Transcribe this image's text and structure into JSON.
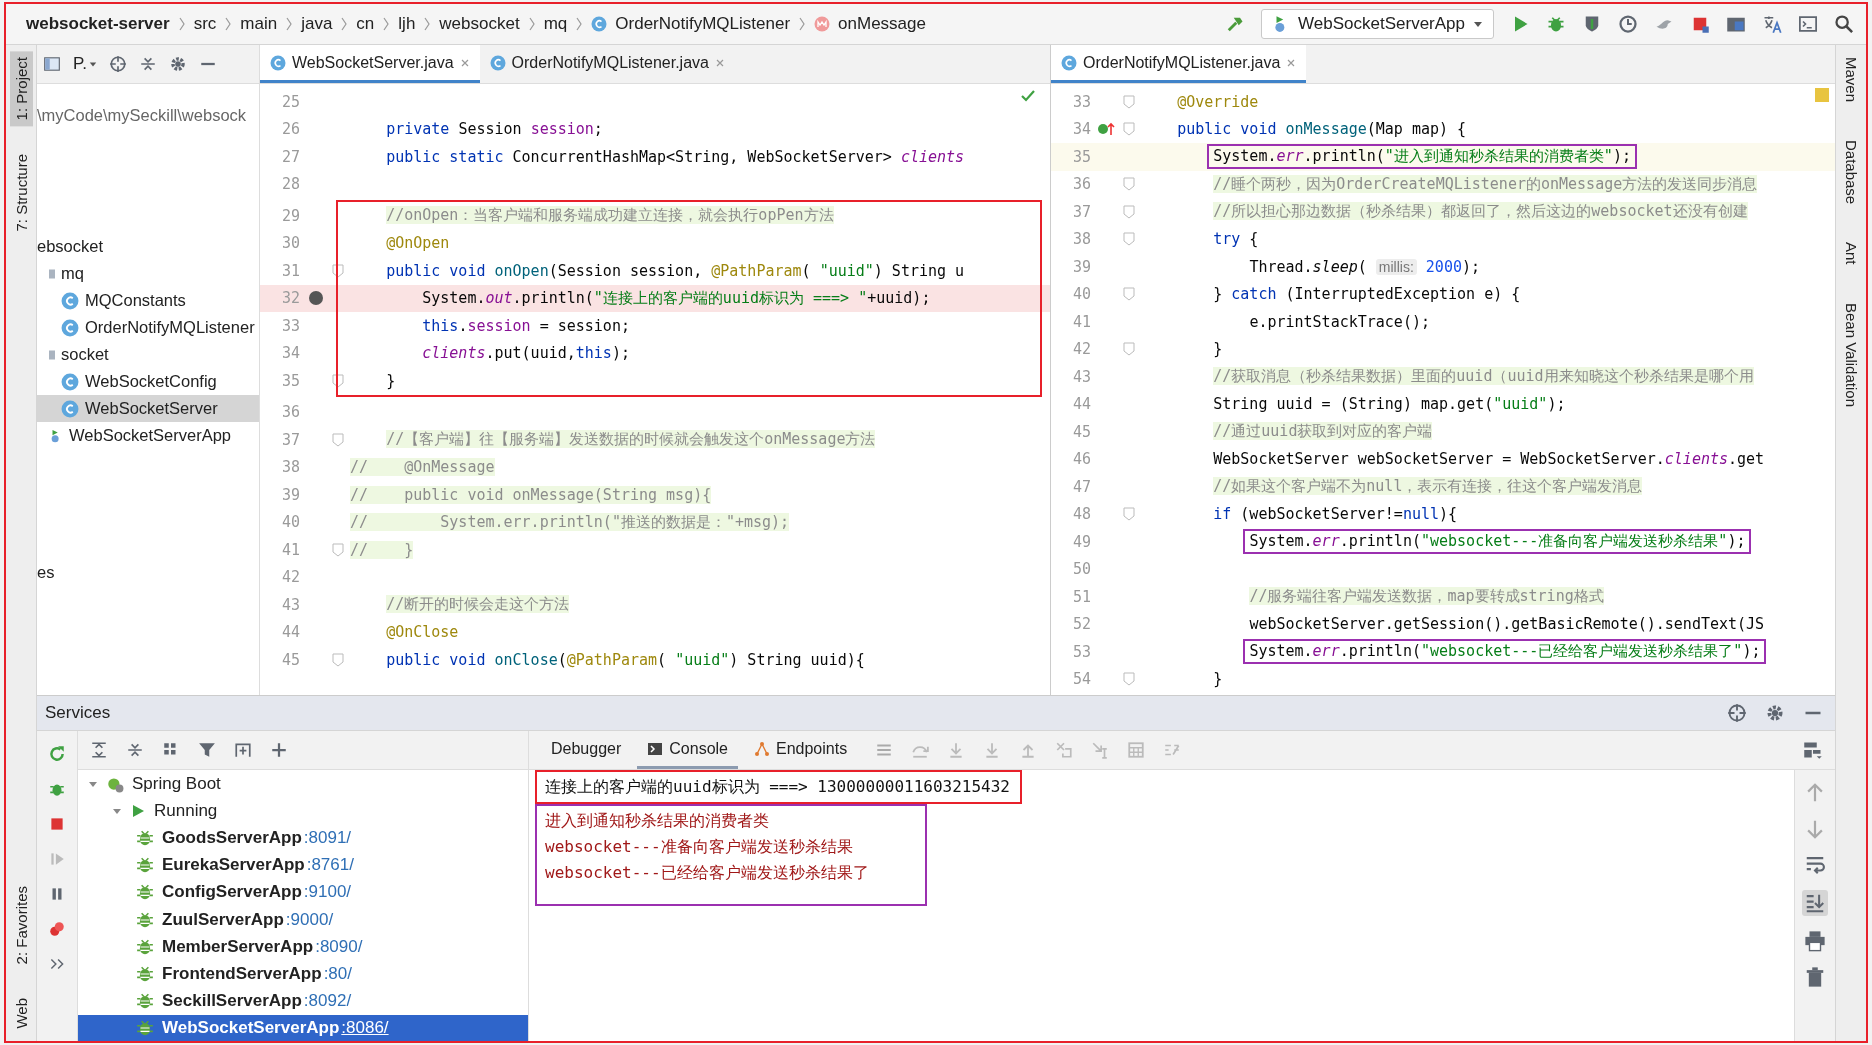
{
  "window": {
    "color": "#e8202a"
  },
  "breadcrumb": [
    {
      "label": "websocket-server",
      "kind": "project"
    },
    {
      "label": "src",
      "kind": "dir"
    },
    {
      "label": "main",
      "kind": "dir"
    },
    {
      "label": "java",
      "kind": "dir"
    },
    {
      "label": "cn",
      "kind": "dir"
    },
    {
      "label": "ljh",
      "kind": "dir"
    },
    {
      "label": "websocket",
      "kind": "dir"
    },
    {
      "label": "mq",
      "kind": "dir"
    },
    {
      "label": "OrderNotifyMQListener",
      "kind": "class"
    },
    {
      "label": "onMessage",
      "kind": "method"
    }
  ],
  "run_config": {
    "label": "WebSocketServerApp"
  },
  "tool_windows_left_top": [
    {
      "label": "1: Project",
      "selected": true
    },
    {
      "label": "7: Structure",
      "selected": false
    }
  ],
  "tool_windows_left_bottom": [
    {
      "label": "2: Favorites",
      "selected": false
    },
    {
      "label": "Web",
      "selected": false
    }
  ],
  "tool_windows_right": [
    {
      "label": "Maven",
      "selected": false
    },
    {
      "label": "Database",
      "selected": false
    },
    {
      "label": "Ant",
      "selected": false
    },
    {
      "label": "Bean Validation",
      "selected": false
    }
  ],
  "project_panel": {
    "title": "P.",
    "items": [
      {
        "label": "\\myCode\\mySeckill\\websock",
        "kind": "path",
        "selected": false
      },
      {
        "label": "ebsocket",
        "kind": "text",
        "selected": false,
        "children": [
          {
            "label": "mq",
            "kind": "folder",
            "selected": false,
            "children": [
              {
                "label": "MQConstants",
                "kind": "class",
                "selected": false
              },
              {
                "label": "OrderNotifyMQListener",
                "kind": "class",
                "selected": false
              }
            ]
          },
          {
            "label": "socket",
            "kind": "folder",
            "selected": false,
            "children": [
              {
                "label": "WebSocketConfig",
                "kind": "class",
                "selected": false
              },
              {
                "label": "WebSocketServer",
                "kind": "class",
                "selected": true
              }
            ]
          },
          {
            "label": "WebSocketServerApp",
            "kind": "app",
            "selected": false
          }
        ]
      },
      {
        "label": "es",
        "kind": "text",
        "selected": false
      }
    ]
  },
  "editors": [
    {
      "tabs": [
        {
          "label": "WebSocketServer.java",
          "selected": true
        },
        {
          "label": "OrderNotifyMQListener.java",
          "selected": false
        }
      ],
      "blocks": [
        {
          "lines": [
            {
              "n": "25",
              "kind": "plain",
              "fold": false
            },
            {
              "n": "26",
              "kind": "plain",
              "fold": false,
              "tokens": [
                {
                  "text": "    private ",
                  "kind": "keyword"
                },
                {
                  "text": "Session ",
                  "kind": "plain"
                },
                {
                  "text": "session",
                  "kind": "field"
                },
                {
                  "text": ";",
                  "kind": "plain"
                }
              ]
            },
            {
              "n": "27",
              "kind": "plain",
              "fold": false,
              "tokens": [
                {
                  "text": "    public static ",
                  "kind": "keyword"
                },
                {
                  "text": "ConcurrentHashMap<String, WebSocketServer> ",
                  "kind": "plain"
                },
                {
                  "text": "clients",
                  "kind": "static"
                }
              ]
            },
            {
              "n": "28",
              "kind": "plain",
              "fold": false
            }
          ]
        },
        {
          "color": "#e8202a",
          "lines": [
            {
              "n": "29",
              "kind": "plain",
              "fold": false,
              "tokens": [
                {
                  "text": "    //onOpen：当客户端和服务端成功建立连接，就会执行opPen方法",
                  "kind": "comment"
                }
              ]
            },
            {
              "n": "30",
              "kind": "plain",
              "fold": false,
              "tokens": [
                {
                  "text": "    @OnOpen",
                  "kind": "annotation"
                }
              ]
            },
            {
              "n": "31",
              "kind": "plain",
              "fold": true,
              "tokens": [
                {
                  "text": "    public void ",
                  "kind": "keyword"
                },
                {
                  "text": "onOpen",
                  "kind": "method"
                },
                {
                  "text": "(Session session, ",
                  "kind": "plain"
                },
                {
                  "text": "@PathParam",
                  "kind": "annotation"
                },
                {
                  "text": "( ",
                  "kind": "plain"
                },
                {
                  "text": "\"uuid\"",
                  "kind": "string"
                },
                {
                  "text": ") String u",
                  "kind": "plain"
                }
              ]
            },
            {
              "n": "32",
              "kind": "breakpoint",
              "fold": false,
              "tokens": [
                {
                  "text": "        System.",
                  "kind": "plain"
                },
                {
                  "text": "out",
                  "kind": "static"
                },
                {
                  "text": ".println(",
                  "kind": "plain"
                },
                {
                  "text": "\"连接上的客户端的uuid标识为 ===> \"",
                  "kind": "string"
                },
                {
                  "text": "+uuid);",
                  "kind": "plain"
                }
              ]
            },
            {
              "n": "33",
              "kind": "plain",
              "fold": false,
              "tokens": [
                {
                  "text": "        this",
                  "kind": "keyword"
                },
                {
                  "text": ".",
                  "kind": "plain"
                },
                {
                  "text": "session",
                  "kind": "field"
                },
                {
                  "text": " = session;",
                  "kind": "plain"
                }
              ]
            },
            {
              "n": "34",
              "kind": "plain",
              "fold": false,
              "tokens": [
                {
                  "text": "        clients",
                  "kind": "static"
                },
                {
                  "text": ".put(uuid,",
                  "kind": "plain"
                },
                {
                  "text": "this",
                  "kind": "keyword"
                },
                {
                  "text": ");",
                  "kind": "plain"
                }
              ]
            },
            {
              "n": "35",
              "kind": "plain",
              "fold": true,
              "tokens": [
                {
                  "text": "    }",
                  "kind": "plain"
                }
              ]
            }
          ]
        },
        {
          "lines": [
            {
              "n": "36",
              "kind": "plain",
              "fold": false
            },
            {
              "n": "37",
              "kind": "plain",
              "fold": true,
              "tokens": [
                {
                  "text": "    //【客户端】往【服务端】发送数据的时候就会触发这个onMessage方法",
                  "kind": "comment"
                }
              ]
            },
            {
              "n": "38",
              "kind": "plain",
              "fold": false,
              "tokens": [
                {
                  "text": "//    @OnMessage",
                  "kind": "comment"
                }
              ]
            },
            {
              "n": "39",
              "kind": "plain",
              "fold": false,
              "tokens": [
                {
                  "text": "//    public void onMessage(String msg){",
                  "kind": "comment"
                }
              ]
            },
            {
              "n": "40",
              "kind": "plain",
              "fold": false,
              "tokens": [
                {
                  "text": "//        System.err.println(\"推送的数据是：\"+msg);",
                  "kind": "comment"
                }
              ]
            },
            {
              "n": "41",
              "kind": "plain",
              "fold": true,
              "tokens": [
                {
                  "text": "//    }",
                  "kind": "comment"
                }
              ]
            },
            {
              "n": "42",
              "kind": "plain",
              "fold": false
            },
            {
              "n": "43",
              "kind": "plain",
              "fold": false,
              "tokens": [
                {
                  "text": "    //断开的时候会走这个方法",
                  "kind": "comment"
                }
              ]
            },
            {
              "n": "44",
              "kind": "plain",
              "fold": false,
              "tokens": [
                {
                  "text": "    @OnClose",
                  "kind": "annotation"
                }
              ]
            },
            {
              "n": "45",
              "kind": "plain",
              "fold": true,
              "tokens": [
                {
                  "text": "    public void ",
                  "kind": "keyword"
                },
                {
                  "text": "onClose",
                  "kind": "method"
                },
                {
                  "text": "(",
                  "kind": "plain"
                },
                {
                  "text": "@PathParam",
                  "kind": "annotation"
                },
                {
                  "text": "( ",
                  "kind": "plain"
                },
                {
                  "text": "\"uuid\"",
                  "kind": "string"
                },
                {
                  "text": ") String uuid){",
                  "kind": "plain"
                }
              ]
            }
          ]
        }
      ]
    },
    {
      "tabs": [
        {
          "label": "OrderNotifyMQListener.java",
          "selected": true
        }
      ],
      "blocks": [
        {
          "lines": [
            {
              "n": "33",
              "kind": "plain",
              "fold": true,
              "tokens": [
                {
                  "text": "    @Override",
                  "kind": "annotation"
                }
              ]
            },
            {
              "n": "34",
              "kind": "implements",
              "fold": true,
              "tokens": [
                {
                  "text": "    public void ",
                  "kind": "keyword"
                },
                {
                  "text": "onMessage",
                  "kind": "method"
                },
                {
                  "text": "(Map map) {",
                  "kind": "plain"
                }
              ]
            },
            {
              "n": "35",
              "kind": "current",
              "fold": false,
              "color": "#9b30b0",
              "tokens": [
                {
                  "text": "        System.",
                  "kind": "plain"
                },
                {
                  "text": "err",
                  "kind": "static"
                },
                {
                  "text": ".println(",
                  "kind": "plain"
                },
                {
                  "text": "\"进入到通知秒杀结果的消费者类\"",
                  "kind": "string"
                },
                {
                  "text": ");",
                  "kind": "plain"
                }
              ]
            },
            {
              "n": "36",
              "kind": "plain",
              "fold": true,
              "tokens": [
                {
                  "text": "        //睡个两秒，因为OrderCreateMQListener的onMessage方法的发送同步消息",
                  "kind": "comment"
                }
              ]
            },
            {
              "n": "37",
              "kind": "plain",
              "fold": true,
              "tokens": [
                {
                  "text": "        //所以担心那边数据（秒杀结果）都返回了，然后这边的websocket还没有创建",
                  "kind": "comment"
                }
              ]
            },
            {
              "n": "38",
              "kind": "plain",
              "fold": true,
              "tokens": [
                {
                  "text": "        try",
                  "kind": "keyword"
                },
                {
                  "text": " {",
                  "kind": "plain"
                }
              ]
            },
            {
              "n": "39",
              "kind": "plain",
              "fold": false,
              "tokens": [
                {
                  "text": "            Thread.",
                  "kind": "plain"
                },
                {
                  "text": "sleep",
                  "kind": "italic"
                },
                {
                  "text": "( ",
                  "kind": "plain"
                },
                {
                  "text": "millis:",
                  "kind": "hint"
                },
                {
                  "text": " 2000",
                  "kind": "number"
                },
                {
                  "text": ");",
                  "kind": "plain"
                }
              ]
            },
            {
              "n": "40",
              "kind": "plain",
              "fold": true,
              "tokens": [
                {
                  "text": "        } ",
                  "kind": "plain"
                },
                {
                  "text": "catch",
                  "kind": "keyword"
                },
                {
                  "text": " (InterruptedException e) {",
                  "kind": "plain"
                }
              ]
            },
            {
              "n": "41",
              "kind": "plain",
              "fold": false,
              "tokens": [
                {
                  "text": "            e.printStackTrace();",
                  "kind": "plain"
                }
              ]
            },
            {
              "n": "42",
              "kind": "plain",
              "fold": true,
              "tokens": [
                {
                  "text": "        }",
                  "kind": "plain"
                }
              ]
            },
            {
              "n": "43",
              "kind": "plain",
              "fold": false,
              "tokens": [
                {
                  "text": "        //获取消息（秒杀结果数据）里面的uuid（uuid用来知晓这个秒杀结果是哪个用",
                  "kind": "comment"
                }
              ]
            },
            {
              "n": "44",
              "kind": "plain",
              "fold": false,
              "tokens": [
                {
                  "text": "        String uuid = (String) map.get(",
                  "kind": "plain"
                },
                {
                  "text": "\"uuid\"",
                  "kind": "string"
                },
                {
                  "text": ");",
                  "kind": "plain"
                }
              ]
            },
            {
              "n": "45",
              "kind": "plain",
              "fold": false,
              "tokens": [
                {
                  "text": "        //通过uuid获取到对应的客户端",
                  "kind": "comment"
                }
              ]
            },
            {
              "n": "46",
              "kind": "plain",
              "fold": false,
              "tokens": [
                {
                  "text": "        WebSocketServer webSocketServer = WebSocketServer.",
                  "kind": "plain"
                },
                {
                  "text": "clients",
                  "kind": "static"
                },
                {
                  "text": ".get",
                  "kind": "plain"
                }
              ]
            },
            {
              "n": "47",
              "kind": "plain",
              "fold": false,
              "tokens": [
                {
                  "text": "        //如果这个客户端不为null，表示有连接，往这个客户端发消息",
                  "kind": "comment"
                }
              ]
            },
            {
              "n": "48",
              "kind": "plain",
              "fold": true,
              "tokens": [
                {
                  "text": "        if",
                  "kind": "keyword"
                },
                {
                  "text": " (webSocketServer!=",
                  "kind": "plain"
                },
                {
                  "text": "null",
                  "kind": "keyword"
                },
                {
                  "text": "){",
                  "kind": "plain"
                }
              ]
            },
            {
              "n": "49",
              "kind": "plain",
              "fold": false,
              "color": "#9b30b0",
              "tokens": [
                {
                  "text": "            System.",
                  "kind": "plain"
                },
                {
                  "text": "err",
                  "kind": "static"
                },
                {
                  "text": ".println(",
                  "kind": "plain"
                },
                {
                  "text": "\"websocket---准备向客户端发送秒杀结果\"",
                  "kind": "string"
                },
                {
                  "text": ");",
                  "kind": "plain"
                }
              ]
            },
            {
              "n": "50",
              "kind": "plain",
              "fold": false
            },
            {
              "n": "51",
              "kind": "plain",
              "fold": false,
              "tokens": [
                {
                  "text": "            //服务端往客户端发送数据，map要转成string格式",
                  "kind": "comment"
                }
              ]
            },
            {
              "n": "52",
              "kind": "plain",
              "fold": false,
              "tokens": [
                {
                  "text": "            webSocketServer.getSession().getBasicRemote().sendText(JS",
                  "kind": "plain"
                }
              ]
            },
            {
              "n": "53",
              "kind": "plain",
              "fold": false,
              "color": "#9b30b0",
              "tokens": [
                {
                  "text": "            System.",
                  "kind": "plain"
                },
                {
                  "text": "err",
                  "kind": "static"
                },
                {
                  "text": ".println(",
                  "kind": "plain"
                },
                {
                  "text": "\"websocket---已经给客户端发送秒杀结果了\"",
                  "kind": "string"
                },
                {
                  "text": ");",
                  "kind": "plain"
                }
              ]
            },
            {
              "n": "54",
              "kind": "plain",
              "fold": true,
              "tokens": [
                {
                  "text": "        }",
                  "kind": "plain"
                }
              ]
            }
          ]
        }
      ]
    }
  ],
  "services": {
    "title": "Services",
    "tree": [
      {
        "label": "Spring Boot",
        "kind": "group",
        "selected": false,
        "children": [
          {
            "label": "Running",
            "kind": "running",
            "selected": false,
            "children": [
              {
                "label": "GoodsServerApp",
                "port": ":8091/",
                "kind": "app",
                "selected": false
              },
              {
                "label": "EurekaServerApp",
                "port": ":8761/",
                "kind": "app",
                "selected": false
              },
              {
                "label": "ConfigServerApp",
                "port": ":9100/",
                "kind": "app",
                "selected": false
              },
              {
                "label": "ZuulServerApp",
                "port": ":9000/",
                "kind": "app",
                "selected": false
              },
              {
                "label": "MemberServerApp",
                "port": ":8090/",
                "kind": "app",
                "selected": false
              },
              {
                "label": "FrontendServerApp",
                "port": ":80/",
                "kind": "app",
                "selected": false
              },
              {
                "label": "SeckillServerApp",
                "port": ":8092/",
                "kind": "app",
                "selected": false
              },
              {
                "label": "WebSocketServerApp",
                "port": ":8086/",
                "kind": "app",
                "selected": true
              }
            ]
          }
        ]
      }
    ],
    "console_tabs": [
      {
        "label": "Debugger",
        "kind": "debugger",
        "selected": false
      },
      {
        "label": "Console",
        "kind": "console",
        "selected": true
      },
      {
        "label": "Endpoints",
        "kind": "endpoints",
        "selected": false
      }
    ],
    "console": [
      {
        "color": "#e8202a",
        "lines": [
          {
            "text": "连接上的客户端的uuid标识为 ===> 13000000011603215432",
            "kind": "out"
          }
        ]
      },
      {
        "color": "#9b30b0",
        "lines": [
          {
            "text": "进入到通知秒杀结果的消费者类",
            "kind": "err"
          },
          {
            "text": "websocket---准备向客户端发送秒杀结果",
            "kind": "err"
          },
          {
            "text": "websocket---已经给客户端发送秒杀结果了",
            "kind": "err"
          }
        ]
      }
    ]
  }
}
